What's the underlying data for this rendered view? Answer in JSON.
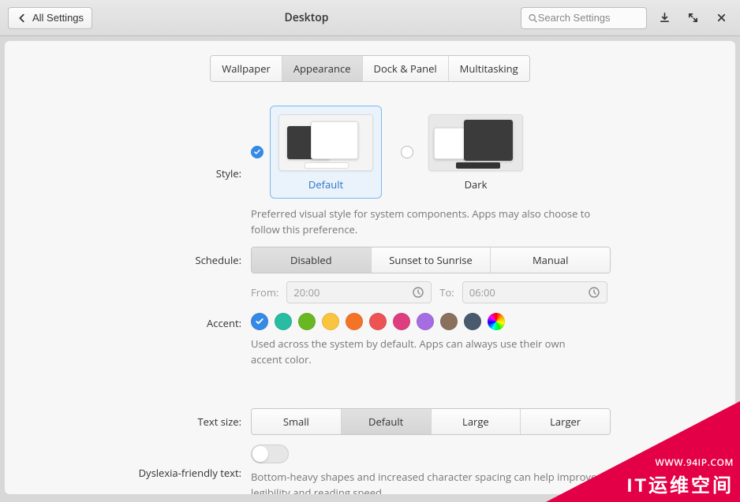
{
  "header": {
    "back_label": "All Settings",
    "title": "Desktop",
    "search_placeholder": "Search Settings"
  },
  "tabs": {
    "items": [
      "Wallpaper",
      "Appearance",
      "Dock & Panel",
      "Multitasking"
    ],
    "active_index": 1
  },
  "style": {
    "label": "Style:",
    "options": [
      {
        "name": "Default",
        "selected": true
      },
      {
        "name": "Dark",
        "selected": false
      }
    ],
    "help": "Preferred visual style for system components. Apps may also choose to follow this preference."
  },
  "schedule": {
    "label": "Schedule:",
    "options": [
      "Disabled",
      "Sunset to Sunrise",
      "Manual"
    ],
    "active_index": 0,
    "from_label": "From:",
    "from_value": "20:00",
    "to_label": "To:",
    "to_value": "06:00"
  },
  "accent": {
    "label": "Accent:",
    "selected_index": 0,
    "colors": [
      "#3689e6",
      "#28bca3",
      "#68b723",
      "#f9c440",
      "#f37329",
      "#ed5353",
      "#de3e80",
      "#a56de2",
      "#8a715e",
      "#485a6c"
    ],
    "rainbow": true,
    "help": "Used across the system by default. Apps can always use their own accent color."
  },
  "text_size": {
    "label": "Text size:",
    "options": [
      "Small",
      "Default",
      "Large",
      "Larger"
    ],
    "active_index": 1
  },
  "dyslexia": {
    "label": "Dyslexia-friendly text:",
    "enabled": false,
    "help": "Bottom-heavy shapes and increased character spacing can help improve legibility and reading speed."
  },
  "watermark": {
    "line1": "WWW.94IP.COM",
    "line2": "IT运维空间"
  }
}
